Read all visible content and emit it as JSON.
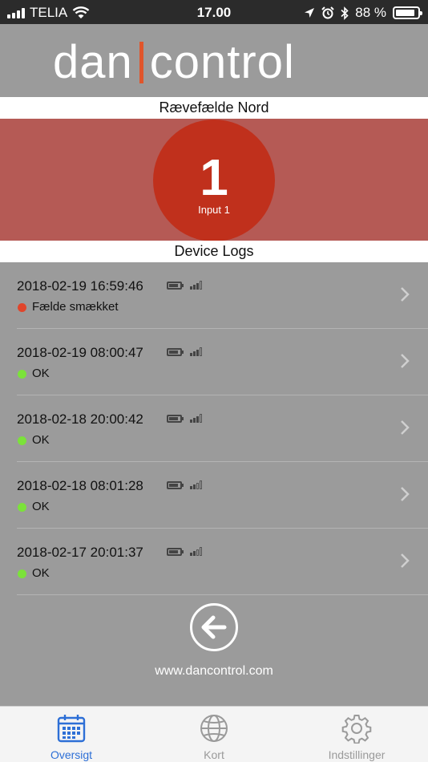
{
  "status_bar": {
    "carrier": "TELIA",
    "time": "17.00",
    "battery_percent": "88 %",
    "battery_level": 0.88,
    "icons": [
      "signal-icon",
      "wifi-icon",
      "location-icon",
      "alarm-icon",
      "bluetooth-icon",
      "battery-icon"
    ]
  },
  "header": {
    "logo_left": "dan",
    "logo_right": "control",
    "logo_accent": "#e0552b"
  },
  "device": {
    "name": "Rævefælde Nord",
    "alarm_number": "1",
    "alarm_label": "Input 1",
    "alarm_color": "#c0301c",
    "band_color": "#b55a55"
  },
  "logs": {
    "heading": "Device Logs",
    "items": [
      {
        "datetime": "2018-02-19 16:59:46",
        "status": "Fælde smækket",
        "status_color": "#e0452b",
        "signal_bars": 3
      },
      {
        "datetime": "2018-02-19 08:00:47",
        "status": "OK",
        "status_color": "#7be23a",
        "signal_bars": 3
      },
      {
        "datetime": "2018-02-18 20:00:42",
        "status": "OK",
        "status_color": "#7be23a",
        "signal_bars": 3
      },
      {
        "datetime": "2018-02-18 08:01:28",
        "status": "OK",
        "status_color": "#7be23a",
        "signal_bars": 2
      },
      {
        "datetime": "2018-02-17 20:01:37",
        "status": "OK",
        "status_color": "#7be23a",
        "signal_bars": 2
      }
    ]
  },
  "footer": {
    "website": "www.dancontrol.com"
  },
  "tabbar": {
    "tabs": [
      {
        "label": "Oversigt",
        "icon": "calendar-icon",
        "active": true
      },
      {
        "label": "Kort",
        "icon": "globe-icon",
        "active": false
      },
      {
        "label": "Indstillinger",
        "icon": "gear-icon",
        "active": false
      }
    ],
    "active_color": "#2d6fd6"
  }
}
